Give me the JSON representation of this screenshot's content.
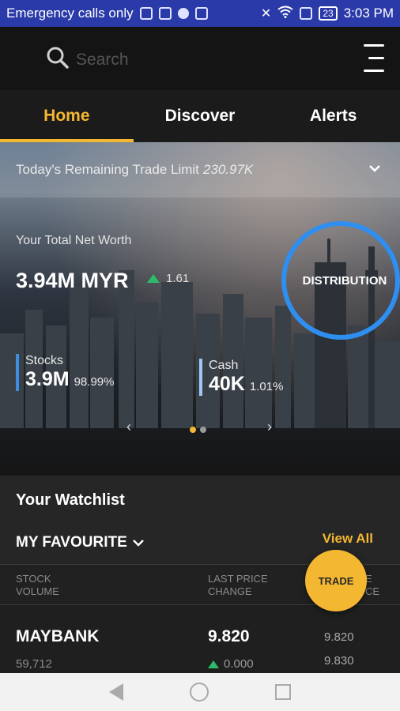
{
  "status_bar": {
    "carrier": "Emergency calls only",
    "battery": "23",
    "time": "3:03 PM"
  },
  "search": {
    "placeholder": "Search"
  },
  "tabs": [
    {
      "label": "Home",
      "active": true
    },
    {
      "label": "Discover",
      "active": false
    },
    {
      "label": "Alerts",
      "active": false
    }
  ],
  "trade_limit": {
    "label": "Today's Remaining Trade Limit",
    "value": "230.97K"
  },
  "net_worth": {
    "label": "Your Total Net Worth",
    "value": "3.94M MYR",
    "change": "1.61"
  },
  "distribution_label": "DISTRIBUTION",
  "holdings": [
    {
      "title": "Stocks",
      "value": "3.9M",
      "percent": "98.99%"
    },
    {
      "title": "Cash",
      "value": "40K",
      "percent": "1.01%"
    }
  ],
  "pager": {
    "prev": "‹",
    "next": "›"
  },
  "watchlist": {
    "title": "Your Watchlist",
    "list_name": "MY FAVOURITE",
    "view_all": "View All",
    "columns": {
      "stock": "STOCK",
      "volume": "VOLUME",
      "last_price": "LAST PRICE",
      "change": "CHANGE",
      "price_partial_1": "E",
      "price_partial_2": "CE"
    },
    "rows": [
      {
        "name": "MAYBANK",
        "volume": "59,712",
        "last": "9.820",
        "change": "0.000",
        "bid": "9.820",
        "ask": "9.830"
      }
    ]
  },
  "trade_button": "TRADE",
  "colors": {
    "accent": "#f4b731",
    "status_bar": "#2a3aa8",
    "ring": "#2f8ff0",
    "up": "#2ebc6b"
  }
}
